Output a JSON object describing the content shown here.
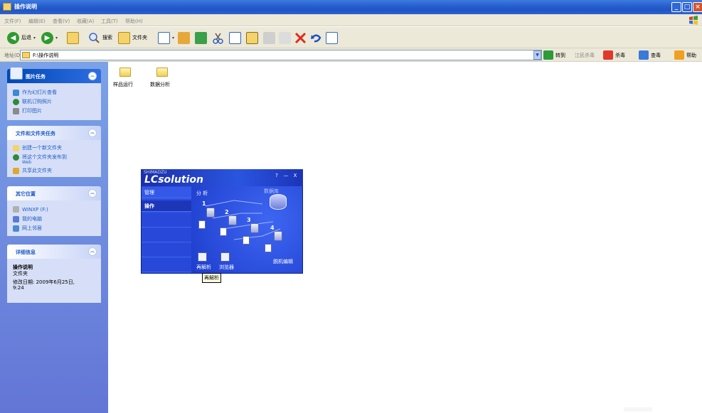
{
  "window": {
    "title": "操作说明"
  },
  "menu": [
    "文件(F)",
    "编辑(E)",
    "查看(V)",
    "收藏(A)",
    "工具(T)",
    "帮助(H)"
  ],
  "toolbar": {
    "back": "后退",
    "forward": "",
    "search": "搜索",
    "folders": "文件夹"
  },
  "address": {
    "label": "地址(D)",
    "value": "F:\\操作说明",
    "go": "转到",
    "links": [
      {
        "label": "江民杀毒"
      },
      {
        "label": "杀毒"
      },
      {
        "label": "查毒"
      },
      {
        "label": "帮助"
      }
    ]
  },
  "taskpane": {
    "picture_tasks": {
      "title": "图片任务",
      "items": [
        "作为幻灯片查看",
        "联机订购照片",
        "打印图片"
      ]
    },
    "file_tasks": {
      "title": "文件和文件夹任务",
      "items": [
        "创建一个新文件夹",
        "将这个文件夹发布到",
        "Web",
        "共享此文件夹"
      ]
    },
    "other_places": {
      "title": "其它位置",
      "items": [
        "WINXP (F:)",
        "我的电脑",
        "网上邻居"
      ]
    },
    "details": {
      "title": "详细信息",
      "name": "操作说明",
      "type": "文件夹",
      "modified": "修改日期: 2009年6月25日,",
      "time": "9:24"
    }
  },
  "folders": [
    "样品运行",
    "数据分析"
  ],
  "lcsolution": {
    "brand": "SHIMADZU",
    "logo": "LCsolution",
    "window_buttons": [
      "?",
      "—",
      "X"
    ],
    "tabs": [
      "管理",
      "操作"
    ],
    "heading": "分 析",
    "database": "数据库",
    "steps": [
      "1",
      "2",
      "3",
      "4"
    ],
    "reanalysis": "再解析",
    "browser": "浏览器",
    "offline": "脱机编辑",
    "tooltip": "再解析"
  }
}
